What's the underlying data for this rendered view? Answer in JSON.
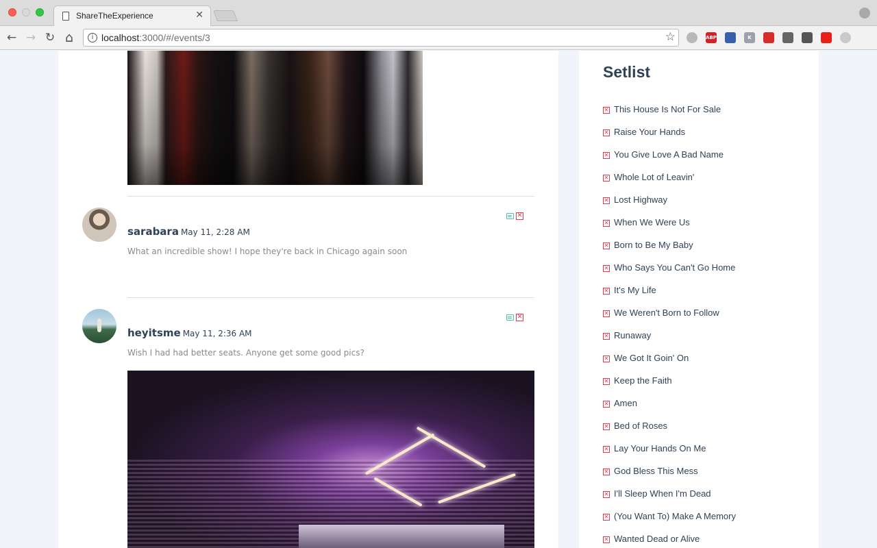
{
  "browser": {
    "tab_title": "ShareTheExperience",
    "tab_close": "✕",
    "url_host": "localhost",
    "url_path": ":3000/#/events/3",
    "info_glyph": "i",
    "star_glyph": "☆",
    "back_glyph": "←",
    "forward_glyph": "→",
    "reload_glyph": "↻",
    "home_glyph": "⌂"
  },
  "extensions": [
    {
      "name": "cloud-ext-icon",
      "label": "",
      "color": "#b8b8b8"
    },
    {
      "name": "adblock-plus-icon",
      "label": "ABP",
      "color": "#d81f26"
    },
    {
      "name": "globe-ext-icon",
      "label": "",
      "color": "#3a5fad"
    },
    {
      "name": "k-ext-icon",
      "label": "K",
      "color": "#9aa3ab"
    },
    {
      "name": "red-ext-icon",
      "label": "",
      "color": "#d82b2b"
    },
    {
      "name": "cast-icon",
      "label": "",
      "color": "#666666"
    },
    {
      "name": "compass-ext-icon",
      "label": "",
      "color": "#555555"
    },
    {
      "name": "youtube-ext-icon",
      "label": "",
      "color": "#e62117"
    },
    {
      "name": "circle-ext-icon",
      "label": "",
      "color": "#c9c9c9"
    }
  ],
  "comments": [
    {
      "username": "sarabara",
      "date": "May 11, 2:28 AM",
      "text": "What an incredible show! I hope they're back in Chicago again soon"
    },
    {
      "username": "heyitsme",
      "date": "May 11, 2:36 AM",
      "text": "Wish I had had better seats. Anyone get some good pics?"
    }
  ],
  "delete_glyph": "✕",
  "setlist": {
    "title": "Setlist",
    "songs": [
      "This House Is Not For Sale",
      "Raise Your Hands",
      "You Give Love A Bad Name",
      "Whole Lot of Leavin'",
      "Lost Highway",
      "When We Were Us",
      "Born to Be My Baby",
      "Who Says You Can't Go Home",
      "It's My Life",
      "We Weren't Born to Follow",
      "Runaway",
      "We Got It Goin' On",
      "Keep the Faith",
      "Amen",
      "Bed of Roses",
      "Lay Your Hands On Me",
      "God Bless This Mess",
      "I'll Sleep When I'm Dead",
      "(You Want To) Make A Memory",
      "Wanted Dead or Alive"
    ]
  },
  "colors": {
    "accent_text": "#2f4256",
    "delete_red": "#e0394a",
    "edit_teal": "#4fc3a8",
    "page_bg": "#f1f4fa"
  }
}
